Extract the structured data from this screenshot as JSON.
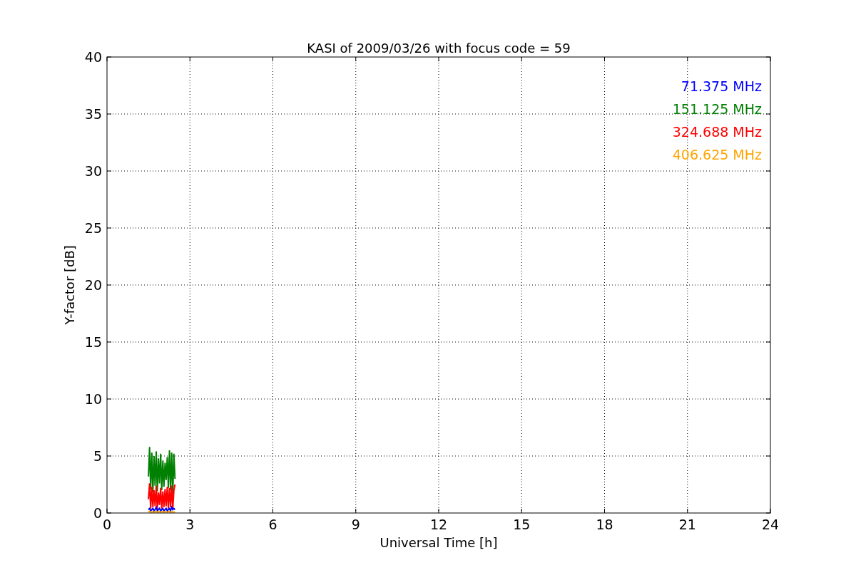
{
  "chart_data": {
    "type": "line",
    "title": "KASI of 2009/03/26 with focus code = 59",
    "xlabel": "Universal Time [h]",
    "ylabel": "Y-factor [dB]",
    "x": [
      1.5,
      1.54,
      1.58,
      1.62,
      1.66,
      1.7,
      1.74,
      1.78,
      1.82,
      1.86,
      1.9,
      1.94,
      1.98,
      2.02,
      2.06,
      2.1,
      2.14,
      2.18,
      2.22,
      2.26,
      2.3,
      2.34,
      2.38,
      2.42,
      2.46
    ],
    "series": [
      {
        "name": "71.375 MHz",
        "color": "#0000ff",
        "values": [
          0.3,
          0.4,
          0.2,
          0.3,
          0.4,
          0.2,
          0.3,
          0.5,
          0.2,
          0.3,
          0.4,
          0.2,
          0.3,
          0.4,
          0.2,
          0.3,
          0.4,
          0.2,
          0.3,
          0.4,
          0.2,
          0.5,
          0.3,
          0.4,
          0.3
        ]
      },
      {
        "name": "151.125 MHz",
        "color": "#008000",
        "values": [
          3.2,
          5.8,
          2.1,
          5.3,
          1.8,
          5.0,
          2.4,
          5.4,
          1.9,
          4.8,
          2.6,
          5.2,
          2.0,
          4.6,
          2.3,
          4.4,
          2.9,
          4.9,
          2.2,
          5.5,
          2.0,
          5.3,
          1.6,
          5.2,
          3.0
        ]
      },
      {
        "name": "324.688 MHz",
        "color": "#ff0000",
        "values": [
          1.2,
          2.6,
          0.4,
          2.3,
          0.5,
          2.0,
          0.6,
          2.4,
          0.3,
          1.8,
          0.7,
          2.2,
          0.4,
          1.9,
          0.5,
          2.1,
          0.6,
          2.3,
          0.4,
          2.2,
          0.5,
          2.4,
          0.3,
          2.0,
          2.5
        ]
      },
      {
        "name": "406.625 MHz",
        "color": "#ffa500",
        "values": [
          0.1,
          0.15,
          0.05,
          0.1,
          0.12,
          0.05,
          0.1,
          0.15,
          0.05,
          0.1,
          0.12,
          0.05,
          0.1,
          0.15,
          0.05,
          0.1,
          0.12,
          0.05,
          0.1,
          0.15,
          0.05,
          0.1,
          0.12,
          0.05,
          0.1
        ]
      }
    ],
    "xlim": [
      0,
      24
    ],
    "ylim": [
      0,
      40
    ],
    "xticks": [
      0,
      3,
      6,
      9,
      12,
      15,
      18,
      21,
      24
    ],
    "yticks": [
      0,
      5,
      10,
      15,
      20,
      25,
      30,
      35,
      40
    ],
    "grid": true
  }
}
